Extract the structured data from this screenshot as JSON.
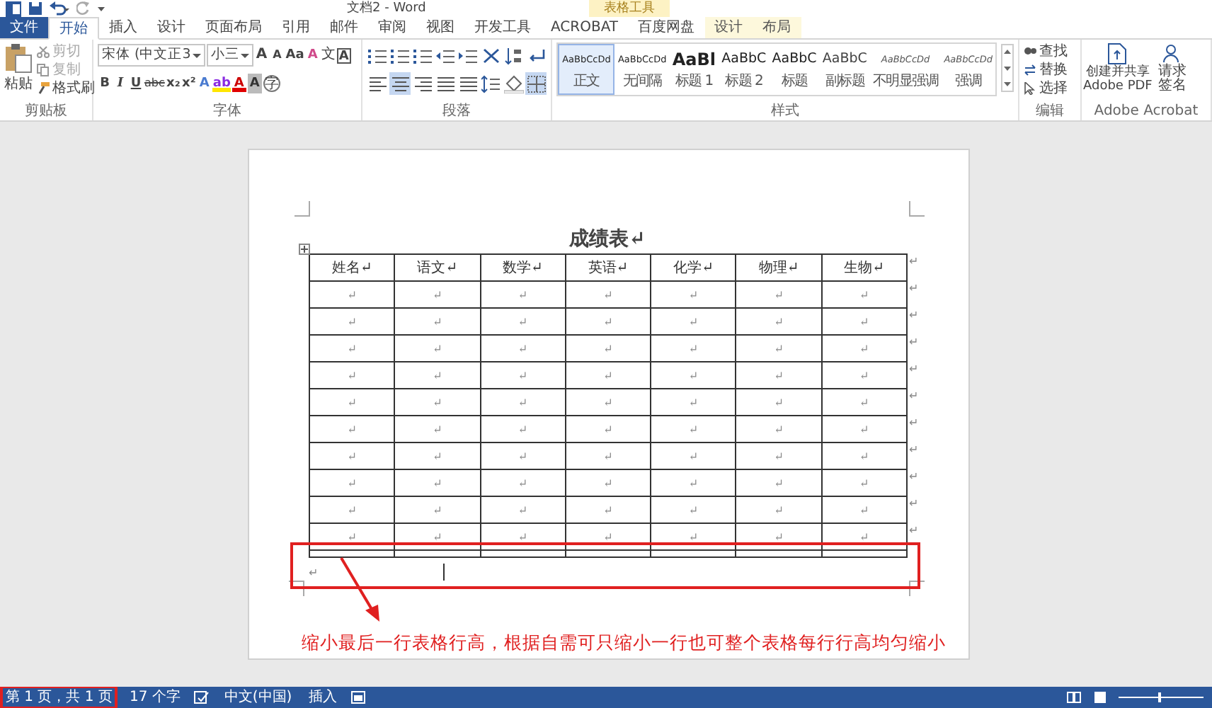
{
  "window": {
    "title": "文档2 - Word",
    "context_group": "表格工具"
  },
  "tabs": [
    {
      "label": "文件",
      "kind": "file",
      "selected": false
    },
    {
      "label": "开始",
      "kind": "normal",
      "selected": true
    },
    {
      "label": "插入",
      "kind": "normal",
      "selected": false
    },
    {
      "label": "设计",
      "kind": "normal",
      "selected": false
    },
    {
      "label": "页面布局",
      "kind": "normal",
      "selected": false
    },
    {
      "label": "引用",
      "kind": "normal",
      "selected": false
    },
    {
      "label": "邮件",
      "kind": "normal",
      "selected": false
    },
    {
      "label": "审阅",
      "kind": "normal",
      "selected": false
    },
    {
      "label": "视图",
      "kind": "normal",
      "selected": false
    },
    {
      "label": "开发工具",
      "kind": "normal",
      "selected": false
    },
    {
      "label": "ACROBAT",
      "kind": "normal",
      "selected": false
    },
    {
      "label": "百度网盘",
      "kind": "normal",
      "selected": false
    },
    {
      "label": "设计",
      "kind": "context",
      "selected": false
    },
    {
      "label": "布局",
      "kind": "context",
      "selected": false
    }
  ],
  "clipboard": {
    "label": "剪贴板",
    "paste": "粘贴",
    "items": [
      {
        "label": "剪切",
        "kind": "cut",
        "disabled": true
      },
      {
        "label": "复制",
        "kind": "copy",
        "disabled": true
      },
      {
        "label": "格式刷",
        "kind": "painter",
        "disabled": false
      }
    ]
  },
  "font": {
    "label": "字体",
    "family": "宋体 (中文正3",
    "size": "小三",
    "row1": [
      {
        "label": "A",
        "kind": "grow"
      },
      {
        "label": "A",
        "kind": "shrink"
      },
      {
        "label": "Aa",
        "kind": "case"
      },
      {
        "label": "A",
        "kind": "clear"
      },
      {
        "label": "文",
        "kind": "phonetic"
      },
      {
        "label": "A",
        "kind": "border"
      }
    ],
    "row2": [
      {
        "label": "B",
        "kind": "bold"
      },
      {
        "label": "I",
        "kind": "italic"
      },
      {
        "label": "U",
        "kind": "underline"
      },
      {
        "label": "abc",
        "kind": "strike"
      },
      {
        "label": "x₂",
        "kind": "sub"
      },
      {
        "label": "x²",
        "kind": "sup"
      },
      {
        "label": "A",
        "kind": "effects"
      },
      {
        "label": "ab",
        "kind": "highlight"
      },
      {
        "label": "A",
        "kind": "color"
      },
      {
        "label": "A",
        "kind": "shading"
      },
      {
        "label": "字",
        "kind": "enclose"
      }
    ]
  },
  "paragraph": {
    "label": "段落",
    "row1": [
      {
        "kind": "bullets",
        "selected": false
      },
      {
        "kind": "numbering",
        "selected": false
      },
      {
        "kind": "multilevel",
        "selected": false
      },
      {
        "kind": "outdent",
        "selected": false
      },
      {
        "kind": "indent",
        "selected": false
      },
      {
        "kind": "asian",
        "selected": false
      },
      {
        "kind": "sort",
        "selected": false
      },
      {
        "kind": "marks",
        "selected": false
      }
    ],
    "row2": [
      {
        "kind": "left",
        "selected": false
      },
      {
        "kind": "center",
        "selected": true
      },
      {
        "kind": "right",
        "selected": false
      },
      {
        "kind": "justify",
        "selected": false
      },
      {
        "kind": "distributed",
        "selected": false
      },
      {
        "kind": "spacing",
        "selected": false
      },
      {
        "kind": "fill",
        "selected": false
      },
      {
        "kind": "borders",
        "selected": true
      }
    ]
  },
  "styles": {
    "label": "样式",
    "items": [
      {
        "preview": "AaBbCcDd",
        "name": "正文",
        "kind": "body",
        "selected": true
      },
      {
        "preview": "AaBbCcDd",
        "name": "无间隔",
        "kind": "body",
        "selected": false
      },
      {
        "preview": "AaBl",
        "name": "标题 1",
        "kind": "heading1",
        "selected": false
      },
      {
        "preview": "AaBbC",
        "name": "标题 2",
        "kind": "heading2",
        "selected": false
      },
      {
        "preview": "AaBbC",
        "name": "标题",
        "kind": "title",
        "selected": false
      },
      {
        "preview": "AaBbC",
        "name": "副标题",
        "kind": "subtitle",
        "selected": false
      },
      {
        "preview": "AaBbCcDd",
        "name": "不明显强调",
        "kind": "emphasis",
        "selected": false
      },
      {
        "preview": "AaBbCcDd",
        "name": "强调",
        "kind": "emphasis",
        "selected": false
      }
    ]
  },
  "editing": {
    "label": "编辑",
    "items": [
      {
        "label": "查找",
        "kind": "find"
      },
      {
        "label": "替换",
        "kind": "replace"
      },
      {
        "label": "选择",
        "kind": "select"
      }
    ]
  },
  "acrobat": {
    "label": "Adobe Acrobat",
    "items": [
      {
        "lines": [
          "创建并共享",
          "Adobe PDF"
        ],
        "kind": "pdf"
      },
      {
        "lines": [
          "请求",
          "签名"
        ],
        "kind": "sign"
      }
    ]
  },
  "document": {
    "title": "成绩表↵",
    "columns": [
      "姓名↵",
      "语文↵",
      "数学↵",
      "英语↵",
      "化学↵",
      "物理↵",
      "生物↵"
    ],
    "header_end_mark": "↵",
    "rows": [
      {
        "kind": "normal",
        "cells": [
          "↵",
          "↵",
          "↵",
          "↵",
          "↵",
          "↵",
          "↵"
        ],
        "end_mark": "↵"
      },
      {
        "kind": "normal",
        "cells": [
          "↵",
          "↵",
          "↵",
          "↵",
          "↵",
          "↵",
          "↵"
        ],
        "end_mark": "↵"
      },
      {
        "kind": "normal",
        "cells": [
          "↵",
          "↵",
          "↵",
          "↵",
          "↵",
          "↵",
          "↵"
        ],
        "end_mark": "↵"
      },
      {
        "kind": "normal",
        "cells": [
          "↵",
          "↵",
          "↵",
          "↵",
          "↵",
          "↵",
          "↵"
        ],
        "end_mark": "↵"
      },
      {
        "kind": "normal",
        "cells": [
          "↵",
          "↵",
          "↵",
          "↵",
          "↵",
          "↵",
          "↵"
        ],
        "end_mark": "↵"
      },
      {
        "kind": "normal",
        "cells": [
          "↵",
          "↵",
          "↵",
          "↵",
          "↵",
          "↵",
          "↵"
        ],
        "end_mark": "↵"
      },
      {
        "kind": "normal",
        "cells": [
          "↵",
          "↵",
          "↵",
          "↵",
          "↵",
          "↵",
          "↵"
        ],
        "end_mark": "↵"
      },
      {
        "kind": "normal",
        "cells": [
          "↵",
          "↵",
          "↵",
          "↵",
          "↵",
          "↵",
          "↵"
        ],
        "end_mark": "↵"
      },
      {
        "kind": "normal",
        "cells": [
          "↵",
          "↵",
          "↵",
          "↵",
          "↵",
          "↵",
          "↵"
        ],
        "end_mark": "↵"
      },
      {
        "kind": "normal",
        "cells": [
          "↵",
          "↵",
          "↵",
          "↵",
          "↵",
          "↵",
          "↵"
        ],
        "end_mark": "↵"
      },
      {
        "kind": "thin"
      }
    ],
    "after_mark": "↵"
  },
  "annotation": {
    "text": "缩小最后一行表格行高，根据自需可只缩小一行也可整个表格每行行高均匀缩小",
    "highlight_last_row": true
  },
  "status_bar": {
    "items": [
      {
        "label": "第 1 页，共 1 页",
        "kind": "text",
        "highlighted": true
      },
      {
        "label": "17 个字",
        "kind": "text",
        "highlighted": false
      },
      {
        "kind": "proofing-icon",
        "highlighted": false
      },
      {
        "label": "中文(中国)",
        "kind": "text",
        "highlighted": false
      },
      {
        "label": "插入",
        "kind": "text",
        "highlighted": false
      },
      {
        "kind": "macro-icon",
        "highlighted": false
      }
    ],
    "zoom_slider": {
      "level": 0.47
    }
  }
}
